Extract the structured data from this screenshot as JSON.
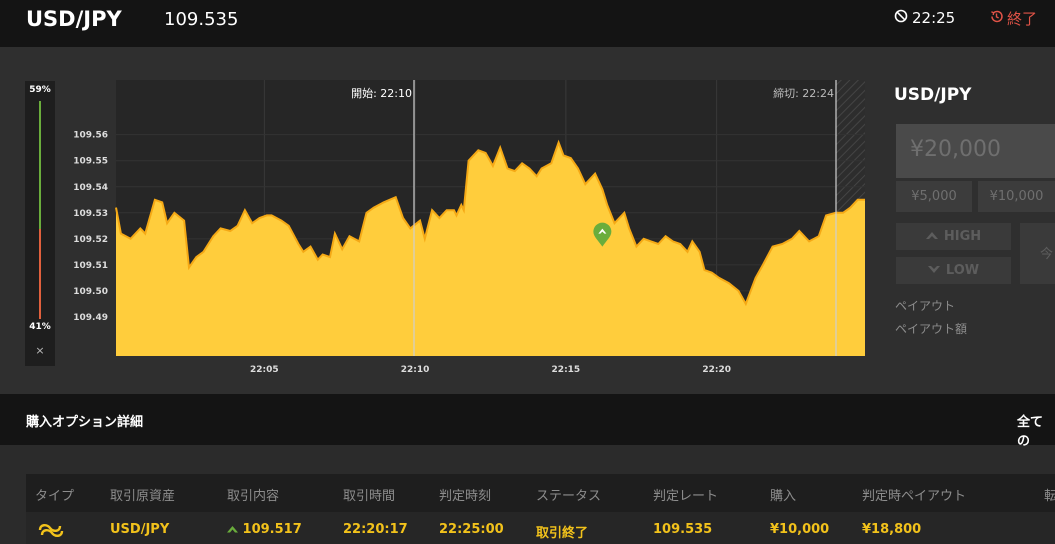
{
  "header": {
    "pair": "USD/JPY",
    "price": "109.535",
    "time": "22:25",
    "end_label": "終了"
  },
  "gauge": {
    "high_pct": "59%",
    "low_pct": "41%",
    "close": "×"
  },
  "chart_data": {
    "type": "area",
    "series_color": "#f5a915",
    "fill_color": "#ffcd3c",
    "y_ticks": [
      "109.56",
      "109.55",
      "109.54",
      "109.53",
      "109.52",
      "109.51",
      "109.50",
      "109.49"
    ],
    "x_ticks": [
      "22:05",
      "22:10",
      "22:15",
      "22:20"
    ],
    "start_label": "開始: 22:10",
    "close_label": "締切: 22:24",
    "ylim": [
      109.475,
      109.581
    ],
    "x_minutes": [
      0,
      24.85
    ],
    "points": [
      [
        0.0,
        109.532
      ],
      [
        0.2,
        109.522
      ],
      [
        0.6,
        109.52
      ],
      [
        1.0,
        109.524
      ],
      [
        1.2,
        109.522
      ],
      [
        1.6,
        109.535
      ],
      [
        1.9,
        109.534
      ],
      [
        2.1,
        109.526
      ],
      [
        2.4,
        109.53
      ],
      [
        2.8,
        109.527
      ],
      [
        3.0,
        109.509
      ],
      [
        3.3,
        109.513
      ],
      [
        3.6,
        109.515
      ],
      [
        4.0,
        109.521
      ],
      [
        4.3,
        109.524
      ],
      [
        4.7,
        109.523
      ],
      [
        5.0,
        109.525
      ],
      [
        5.3,
        109.531
      ],
      [
        5.6,
        109.526
      ],
      [
        5.9,
        109.528
      ],
      [
        6.2,
        109.529
      ],
      [
        6.4,
        109.529
      ],
      [
        6.8,
        109.527
      ],
      [
        7.1,
        109.525
      ],
      [
        7.5,
        109.518
      ],
      [
        7.7,
        109.515
      ],
      [
        8.0,
        109.517
      ],
      [
        8.3,
        109.512
      ],
      [
        8.5,
        109.514
      ],
      [
        8.8,
        109.513
      ],
      [
        9.0,
        109.522
      ],
      [
        9.3,
        109.516
      ],
      [
        9.6,
        109.521
      ],
      [
        10.0,
        109.519
      ],
      [
        10.3,
        109.53
      ],
      [
        10.6,
        109.532
      ],
      [
        11.0,
        109.534
      ],
      [
        11.5,
        109.536
      ],
      [
        11.8,
        109.528
      ],
      [
        12.1,
        109.524
      ],
      [
        12.5,
        109.527
      ],
      [
        12.7,
        109.52
      ],
      [
        13.0,
        109.531
      ],
      [
        13.3,
        109.528
      ],
      [
        13.6,
        109.531
      ],
      [
        13.9,
        109.531
      ],
      [
        14.0,
        109.529
      ],
      [
        14.2,
        109.533
      ],
      [
        14.3,
        109.531
      ],
      [
        14.5,
        109.55
      ],
      [
        14.9,
        109.554
      ],
      [
        15.2,
        109.553
      ],
      [
        15.5,
        109.548
      ],
      [
        15.8,
        109.555
      ],
      [
        16.1,
        109.547
      ],
      [
        16.4,
        109.546
      ],
      [
        16.7,
        109.549
      ],
      [
        17.0,
        109.547
      ],
      [
        17.3,
        109.544
      ],
      [
        17.5,
        109.547
      ],
      [
        17.9,
        109.549
      ],
      [
        18.2,
        109.557
      ],
      [
        18.4,
        109.552
      ],
      [
        18.7,
        109.551
      ],
      [
        19.0,
        109.547
      ],
      [
        19.3,
        109.541
      ],
      [
        19.7,
        109.545
      ],
      [
        20.0,
        109.539
      ],
      [
        20.2,
        109.533
      ],
      [
        20.5,
        109.526
      ],
      [
        20.9,
        109.53
      ],
      [
        21.1,
        109.524
      ],
      [
        21.4,
        109.517
      ],
      [
        21.7,
        109.52
      ],
      [
        22.0,
        109.519
      ],
      [
        22.3,
        109.518
      ],
      [
        22.6,
        109.521
      ],
      [
        22.9,
        109.519
      ],
      [
        23.2,
        109.518
      ],
      [
        23.5,
        109.515
      ],
      [
        23.7,
        109.519
      ],
      [
        24.0,
        109.515
      ],
      [
        24.2,
        109.508
      ],
      [
        24.5,
        109.507
      ],
      [
        24.8,
        109.505
      ],
      [
        25.2,
        109.503
      ],
      [
        25.6,
        109.5
      ],
      [
        25.9,
        109.495
      ],
      [
        26.3,
        109.505
      ],
      [
        26.6,
        109.51
      ],
      [
        27.0,
        109.517
      ],
      [
        27.4,
        109.518
      ],
      [
        27.8,
        109.52
      ],
      [
        28.1,
        109.523
      ],
      [
        28.5,
        109.519
      ],
      [
        28.9,
        109.521
      ],
      [
        29.2,
        109.529
      ],
      [
        29.6,
        109.53
      ],
      [
        29.9,
        109.53
      ],
      [
        30.2,
        109.532
      ],
      [
        30.5,
        109.535
      ],
      [
        30.8,
        109.535
      ]
    ],
    "marker": {
      "x": 20.0,
      "y": 109.517
    }
  },
  "panel": {
    "pair": "USD/JPY",
    "amount": "¥20,000",
    "chip1": "¥5,000",
    "chip2": "¥10,000",
    "high": "HIGH",
    "low": "LOW",
    "buy_partial": "今",
    "payout": "ペイアウト",
    "payout_amount": "ペイアウト額"
  },
  "section": {
    "title": "購入オプション詳細",
    "right": "全ての"
  },
  "table": {
    "headers": [
      "タイプ",
      "取引原資産",
      "取引内容",
      "取引時間",
      "判定時刻",
      "ステータス",
      "判定レート",
      "購入",
      "判定時ペイアウト",
      "転"
    ],
    "row": {
      "asset": "USD/JPY",
      "content": "109.517",
      "time": "22:20:17",
      "judge_time": "22:25:00",
      "status": "取引終了",
      "rate": "109.535",
      "purchase": "¥10,000",
      "payout": "¥18,800"
    }
  }
}
